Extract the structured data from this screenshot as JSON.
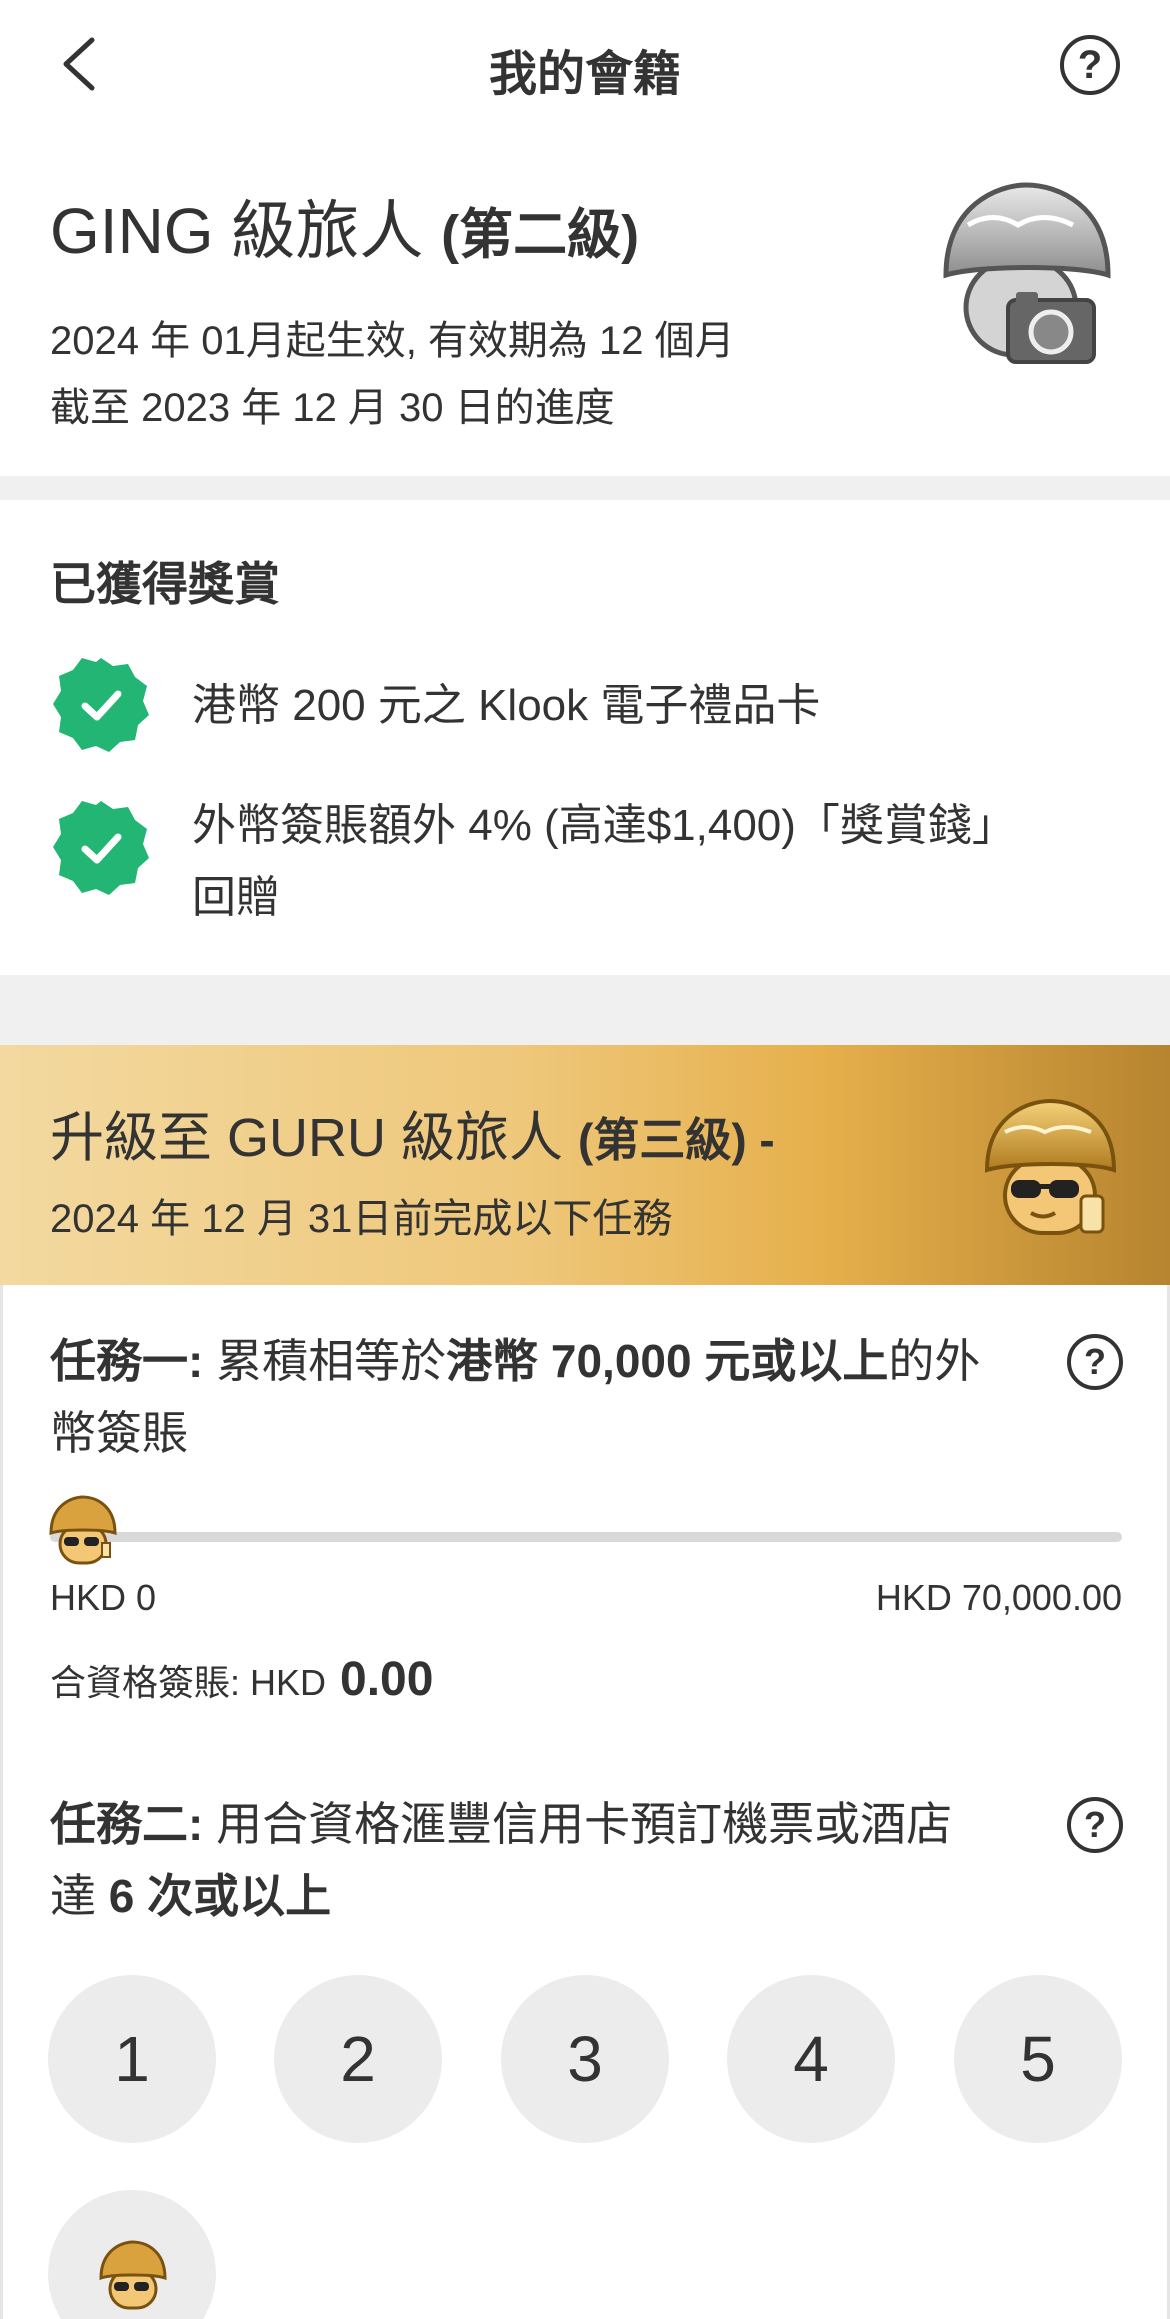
{
  "header": {
    "title": "我的會籍",
    "back_icon": "chevron-left-icon",
    "help_label": "?"
  },
  "tier": {
    "name": "GING 級旅人",
    "level": "(第二級)",
    "effective": "2024 年 01月起生效, 有效期為 12 個月",
    "progress_as_of": "截至 2023 年 12 月 30 日的進度"
  },
  "rewards": {
    "title": "已獲得獎賞",
    "items": [
      {
        "text": "港幣 200 元之 Klook 電子禮品卡"
      },
      {
        "line1": "外幣簽賬額外 4% (高達$1,400)「獎賞錢」",
        "line2": "回贈"
      }
    ]
  },
  "upgrade": {
    "title": "升級至 GURU 級旅人",
    "level": "(第三級) -",
    "deadline": "2024 年 12 月 31日前完成以下任務"
  },
  "task1": {
    "label": "任務一:",
    "text_a": " 累積相等於",
    "text_bold": "港幣 70,000 元或以上",
    "text_b": "的外",
    "line2": "幣簽賬",
    "progress": 0,
    "min_label": "HKD 0",
    "max_label": "HKD 70,000.00",
    "amount_label": "合資格簽賬: HKD",
    "amount_value": "0.00"
  },
  "task2": {
    "label": "任務二:",
    "text_a": " 用合資格滙豐信用卡預訂機票或酒店",
    "line2_a": "達 ",
    "line2_bold": "6 次或以上",
    "steps": [
      "1",
      "2",
      "3",
      "4",
      "5"
    ],
    "completed": 0
  },
  "colors": {
    "reward_badge": "#22b573",
    "banner_gold": "#e6b04c",
    "track": "#d9d9d9",
    "circle": "#ececec"
  }
}
